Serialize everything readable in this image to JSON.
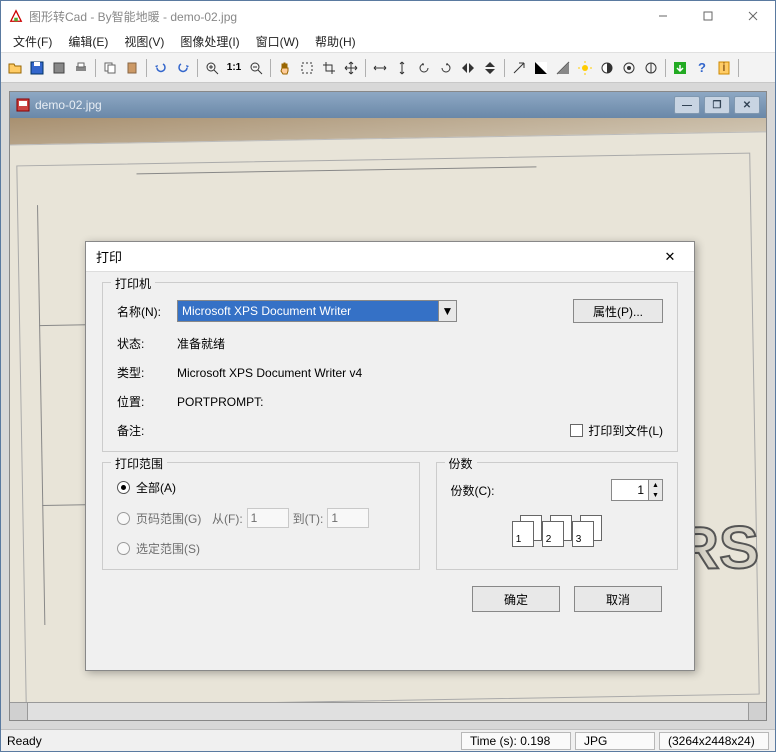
{
  "window": {
    "title": "图形转Cad - By智能地暖 - demo-02.jpg"
  },
  "menus": [
    "文件(F)",
    "编辑(E)",
    "视图(V)",
    "图像处理(I)",
    "窗口(W)",
    "帮助(H)"
  ],
  "child_window": {
    "title": "demo-02.jpg"
  },
  "print_dialog": {
    "title": "打印",
    "printer_group": "打印机",
    "name_label": "名称(N):",
    "name_value": "Microsoft XPS Document Writer",
    "properties_btn": "属性(P)...",
    "status_label": "状态:",
    "status_value": "准备就绪",
    "type_label": "类型:",
    "type_value": "Microsoft XPS Document Writer v4",
    "where_label": "位置:",
    "where_value": "PORTPROMPT:",
    "comment_label": "备注:",
    "print_to_file": "打印到文件(L)",
    "range_group": "打印范围",
    "range_all": "全部(A)",
    "range_pages": "页码范围(G)",
    "range_from": "从(F):",
    "range_to": "到(T):",
    "range_from_val": "1",
    "range_to_val": "1",
    "range_selection": "选定范围(S)",
    "copies_group": "份数",
    "copies_label": "份数(C):",
    "copies_value": "1",
    "ok_btn": "确定",
    "cancel_btn": "取消"
  },
  "status": {
    "ready": "Ready",
    "time": "Time (s): 0.198",
    "fmt": "JPG",
    "dim": "(3264x2448x24)"
  }
}
